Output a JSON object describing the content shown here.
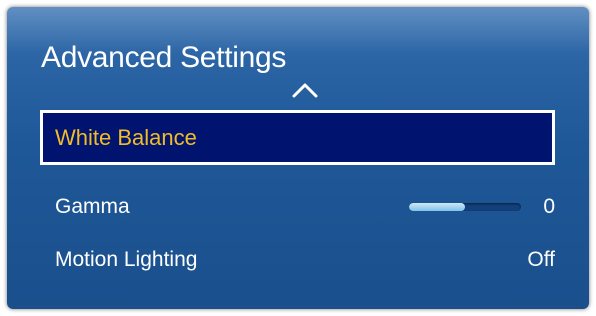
{
  "panel": {
    "title": "Advanced Settings"
  },
  "menu": {
    "items": [
      {
        "label": "White Balance",
        "selected": true
      },
      {
        "label": "Gamma",
        "value": "0",
        "slider_fraction": 0.5
      },
      {
        "label": "Motion Lighting",
        "value": "Off"
      }
    ]
  },
  "colors": {
    "panel_blue": "#1f5898",
    "selected_bg": "#00136f",
    "selected_text": "#f2bb2a",
    "text": "#ffffff"
  },
  "icons": {
    "scroll_up": "chevron-up-icon"
  }
}
